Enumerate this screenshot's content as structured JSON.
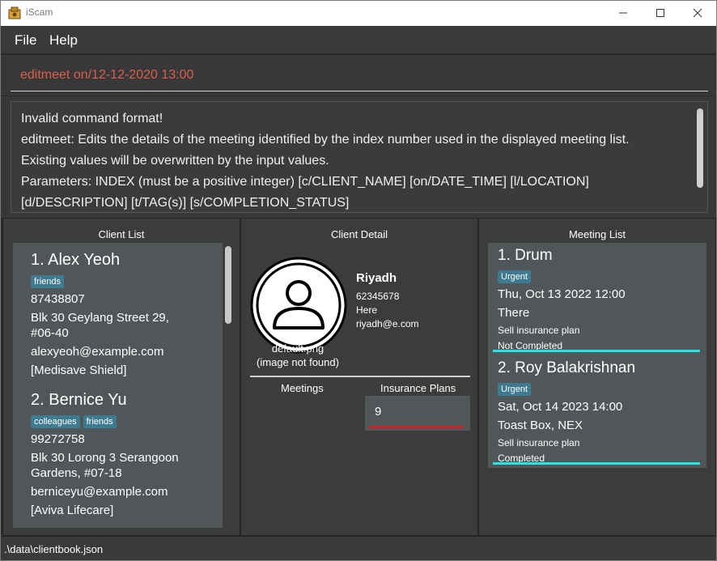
{
  "window": {
    "title": "iScam"
  },
  "menu": {
    "file": "File",
    "help": "Help"
  },
  "command": {
    "value": "editmeet on/12-12-2020 13:00"
  },
  "result": {
    "lines": [
      "Invalid command format!",
      "editmeet: Edits the details of the meeting identified by the index number used in the displayed meeting list.",
      "Existing values will be overwritten by the input values.",
      "Parameters: INDEX (must be a positive integer) [c/CLIENT_NAME] [on/DATE_TIME] [l/LOCATION]",
      "[d/DESCRIPTION] [t/TAG(s)] [s/COMPLETION_STATUS]"
    ]
  },
  "client_list": {
    "title": "Client List",
    "clients": [
      {
        "name": "1.  Alex Yeoh",
        "tags": [
          "friends"
        ],
        "phone": "87438807",
        "address": "Blk 30 Geylang Street 29, #06-40",
        "email": "alexyeoh@example.com",
        "plans": "[Medisave Shield]"
      },
      {
        "name": "2.  Bernice Yu",
        "tags": [
          "colleagues",
          "friends"
        ],
        "phone": "99272758",
        "address": "Blk 30 Lorong 3 Serangoon Gardens, #07-18",
        "email": "berniceyu@example.com",
        "plans": "[Aviva Lifecare]"
      }
    ]
  },
  "client_detail": {
    "title": "Client Detail",
    "name": "Riyadh",
    "phone": "62345678",
    "address": "Here",
    "email": "riyadh@e.com",
    "image_caption_1": "default.png",
    "image_caption_2": "(image not found)",
    "meetings_label": "Meetings",
    "plans_label": "Insurance Plans",
    "plan_value": "9"
  },
  "meeting_list": {
    "title": "Meeting List",
    "meetings": [
      {
        "name": "1.  Drum",
        "tag": "Urgent",
        "datetime": "Thu, Oct 13 2022 12:00",
        "location": "There",
        "description": "Sell insurance plan",
        "status": "Not Completed"
      },
      {
        "name": "2.  Roy Balakrishnan",
        "tag": "Urgent",
        "datetime": "Sat, Oct 14 2023 14:00",
        "location": "Toast Box, NEX",
        "description": "Sell insurance plan",
        "status": "Completed"
      }
    ]
  },
  "status_bar": {
    "path": ".\\data\\clientbook.json"
  },
  "colors": {
    "accent": "#21e6e6",
    "error_underline": "#c8202a",
    "command_text": "#d8604d",
    "tag": "#3e7b91"
  }
}
